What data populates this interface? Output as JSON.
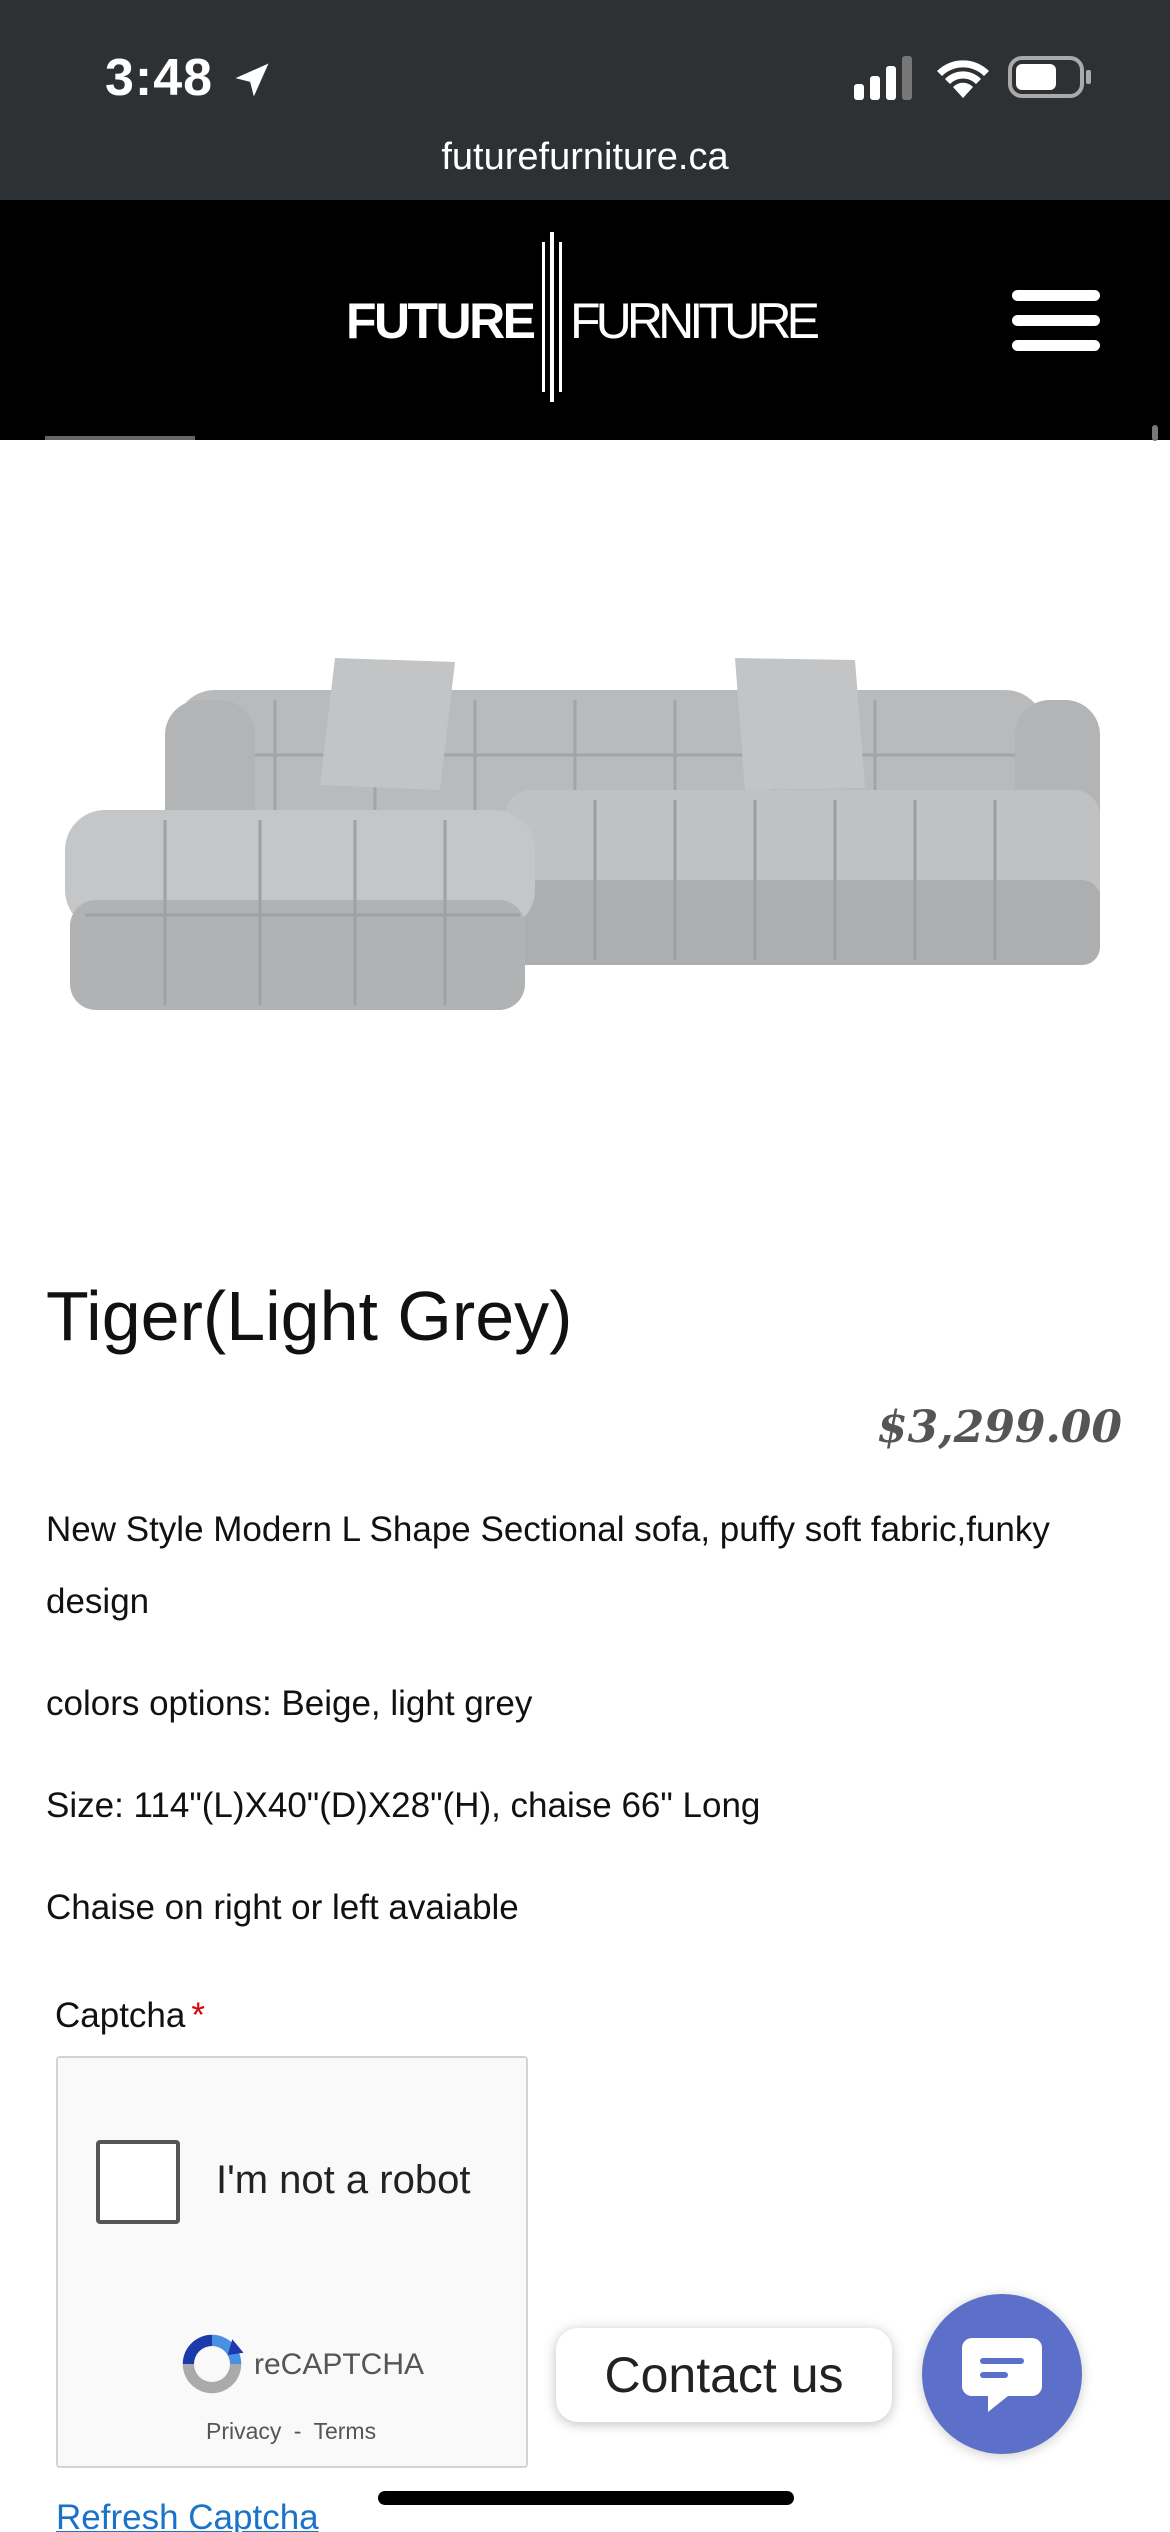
{
  "status_bar": {
    "time": "3:48",
    "url": "futurefurniture.ca",
    "icons": [
      "location-arrow-icon",
      "cellular-signal-icon",
      "wifi-icon",
      "battery-icon"
    ]
  },
  "header": {
    "logo_text_left": "FUTURE",
    "logo_text_right": "FURNITURE",
    "menu_icon": "hamburger-menu-icon"
  },
  "product": {
    "title": "Tiger(Light Grey)",
    "price": "$3,299.00",
    "description": [
      "New Style Modern L Shape Sectional sofa, puffy soft fabric,funky design",
      "colors options: Beige, light grey",
      "Size: 114\"(L)X40\"(D)X28\"(H), chaise 66\" Long",
      "Chaise on right or left avaiable"
    ]
  },
  "captcha": {
    "label": "Captcha",
    "required_mark": "*",
    "checkbox_text": "I'm not a robot",
    "brand": "reCAPTCHA",
    "privacy": "Privacy",
    "separator": "-",
    "terms": "Terms",
    "refresh": "Refresh Captcha"
  },
  "contact": {
    "label": "Contact us",
    "icon": "chat-bubble-icon",
    "color": "#5c6fc9"
  }
}
